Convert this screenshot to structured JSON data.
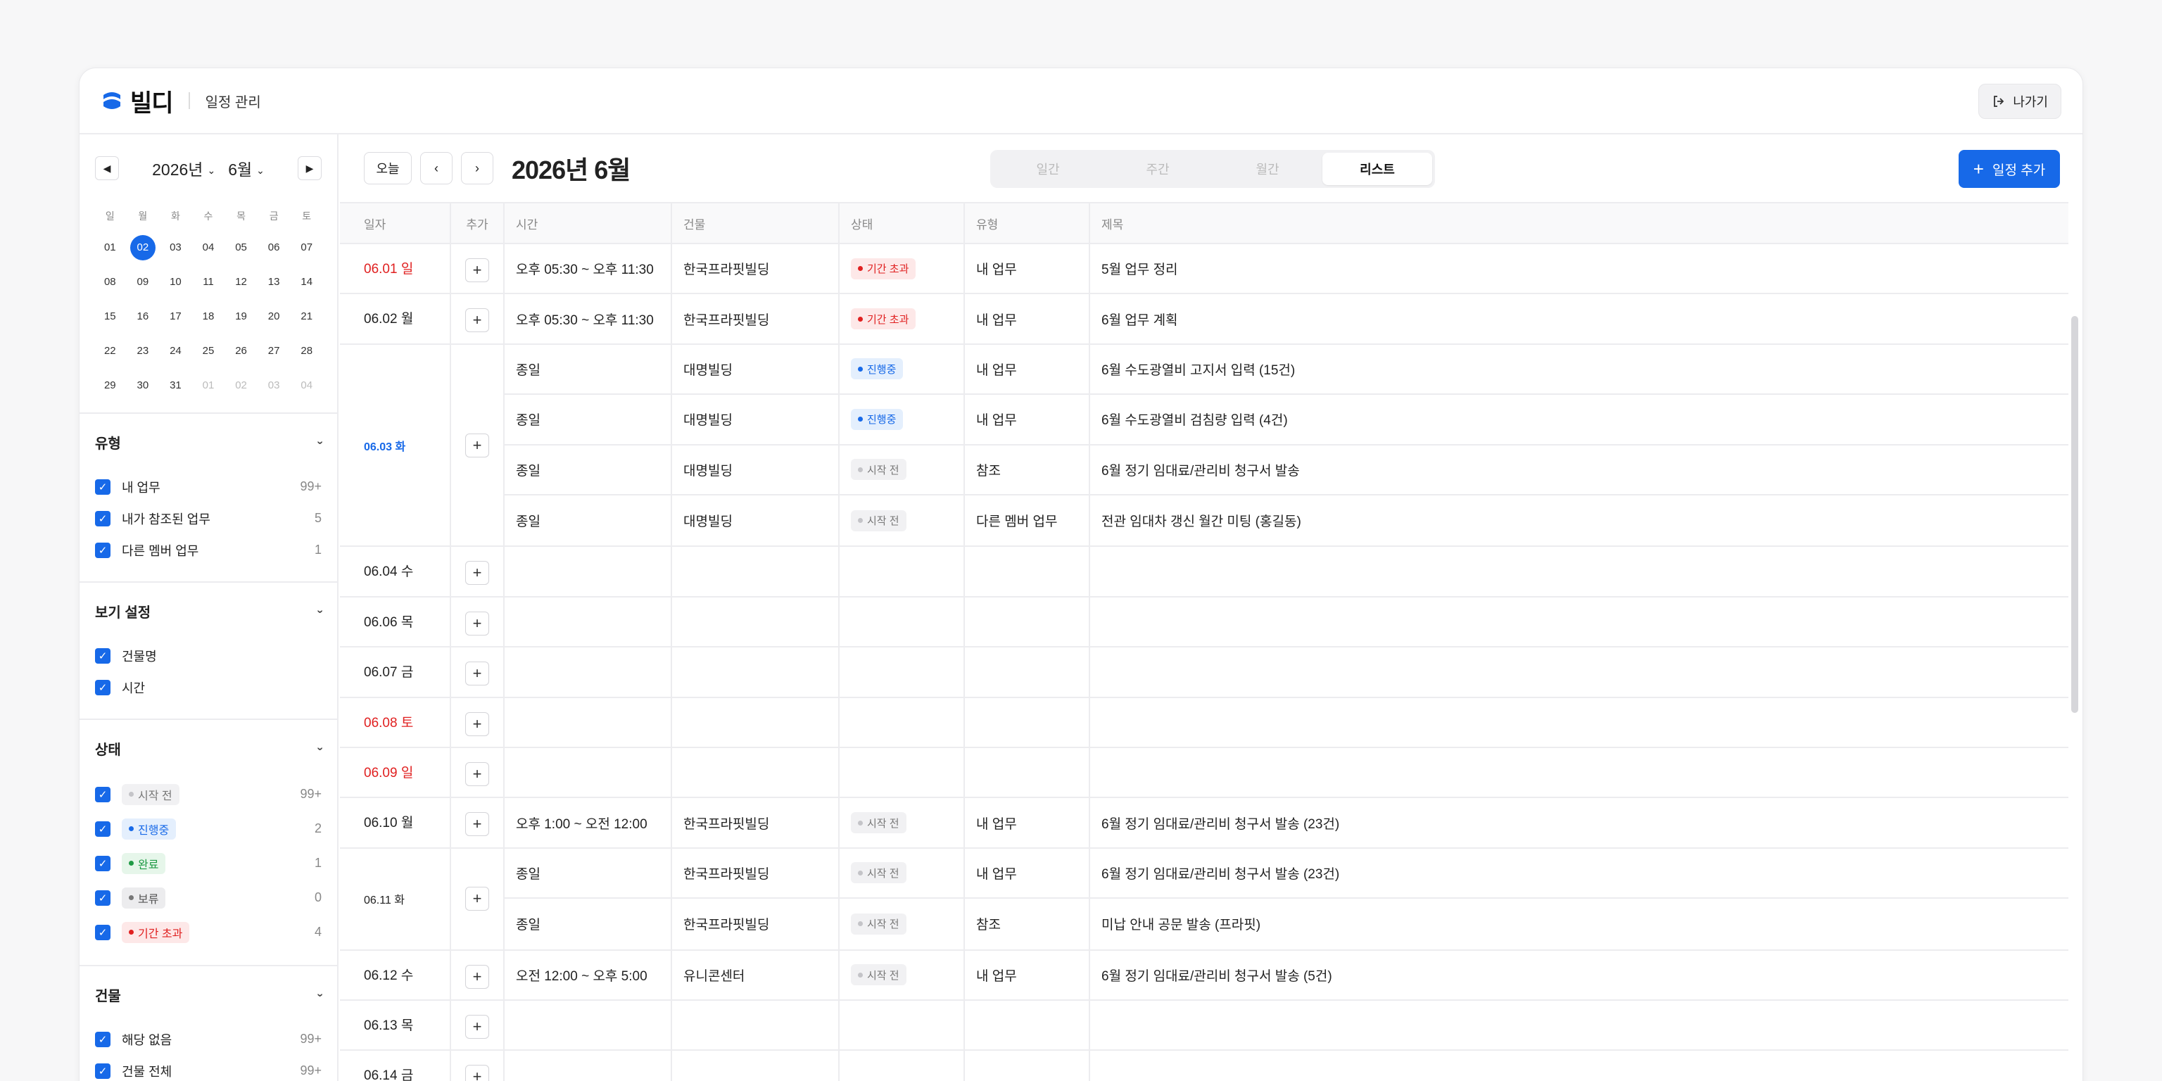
{
  "header": {
    "brand": "빌디",
    "title": "일정 관리",
    "exit_label": "나가기"
  },
  "sidebar": {
    "year": "2026년",
    "month": "6월",
    "dow": [
      "일",
      "월",
      "화",
      "수",
      "목",
      "금",
      "토"
    ],
    "days": [
      "01",
      "02",
      "03",
      "04",
      "05",
      "06",
      "07",
      "08",
      "09",
      "10",
      "11",
      "12",
      "13",
      "14",
      "15",
      "16",
      "17",
      "18",
      "19",
      "20",
      "21",
      "22",
      "23",
      "24",
      "25",
      "26",
      "27",
      "28",
      "29",
      "30",
      "31",
      "01",
      "02",
      "03",
      "04"
    ],
    "selected_day": "02",
    "type_section": {
      "title": "유형",
      "items": [
        {
          "label": "내 업무",
          "count": "99+"
        },
        {
          "label": "내가 참조된 업무",
          "count": "5"
        },
        {
          "label": "다른 멤버 업무",
          "count": "1"
        }
      ]
    },
    "view_section": {
      "title": "보기 설정",
      "items": [
        {
          "label": "건물명"
        },
        {
          "label": "시간"
        }
      ]
    },
    "status_section": {
      "title": "상태",
      "items": [
        {
          "label": "시작 전",
          "count": "99+"
        },
        {
          "label": "진행중",
          "count": "2"
        },
        {
          "label": "완료",
          "count": "1"
        },
        {
          "label": "보류",
          "count": "0"
        },
        {
          "label": "기간 초과",
          "count": "4"
        }
      ]
    },
    "building_section": {
      "title": "건물",
      "items": [
        {
          "label": "해당 없음",
          "count": "99+"
        },
        {
          "label": "건물 전체",
          "count": "99+"
        }
      ]
    }
  },
  "toolbar": {
    "today": "오늘",
    "title": "2026년 6월",
    "views": [
      "일간",
      "주간",
      "월간",
      "리스트"
    ],
    "active_view": "리스트",
    "add_label": "일정 추가"
  },
  "table": {
    "headers": {
      "date": "일자",
      "add": "추가",
      "time": "시간",
      "building": "건물",
      "status": "상태",
      "type": "유형",
      "title": "제목"
    },
    "rows": [
      {
        "date": "06.01 일",
        "time": "오후 05:30 ~ 오후 11:30",
        "building": "한국프라핏빌딩",
        "status": "기간 초과",
        "type": "내 업무",
        "title": "5월 업무 정리"
      },
      {
        "date": "06.02 월",
        "time": "오후 05:30 ~ 오후 11:30",
        "building": "한국프라핏빌딩",
        "status": "기간 초과",
        "type": "내 업무",
        "title": "6월 업무 계획"
      },
      {
        "date": "06.03 화",
        "items": [
          {
            "time": "종일",
            "building": "대명빌딩",
            "status": "진행중",
            "type": "내 업무",
            "title": "6월 수도광열비 고지서 입력 (15건)"
          },
          {
            "time": "종일",
            "building": "대명빌딩",
            "status": "진행중",
            "type": "내 업무",
            "title": "6월 수도광열비 검침량 입력 (4건)"
          },
          {
            "time": "종일",
            "building": "대명빌딩",
            "status": "시작 전",
            "type": "참조",
            "title": "6월 정기 임대료/관리비 청구서 발송"
          },
          {
            "time": "종일",
            "building": "대명빌딩",
            "status": "시작 전",
            "type": "다른 멤버 업무",
            "title": "전관 임대차 갱신 월간 미팅 (홍길동)"
          }
        ]
      },
      {
        "date": "06.04 수"
      },
      {
        "date": "06.06 목"
      },
      {
        "date": "06.07 금"
      },
      {
        "date": "06.08 토"
      },
      {
        "date": "06.09 일"
      },
      {
        "date": "06.10 월",
        "time": "오후 1:00 ~ 오전 12:00",
        "building": "한국프라핏빌딩",
        "status": "시작 전",
        "type": "내 업무",
        "title": "6월 정기 임대료/관리비 청구서 발송 (23건)"
      },
      {
        "date": "06.11 화",
        "items": [
          {
            "time": "종일",
            "building": "한국프라핏빌딩",
            "status": "시작 전",
            "type": "내 업무",
            "title": "6월 정기 임대료/관리비 청구서 발송 (23건)"
          },
          {
            "time": "종일",
            "building": "한국프라핏빌딩",
            "status": "시작 전",
            "type": "참조",
            "title": "미납 안내 공문 발송 (프라핏)"
          }
        ]
      },
      {
        "date": "06.12 수",
        "time": "오전 12:00 ~ 오후 5:00",
        "building": "유니콘센터",
        "status": "시작 전",
        "type": "내 업무",
        "title": "6월 정기 임대료/관리비 청구서 발송 (5건)"
      },
      {
        "date": "06.13 목"
      },
      {
        "date": "06.14 금"
      }
    ]
  },
  "colors": {
    "accent": "#1769e8",
    "danger": "#e02020",
    "success": "#1f9a45"
  }
}
